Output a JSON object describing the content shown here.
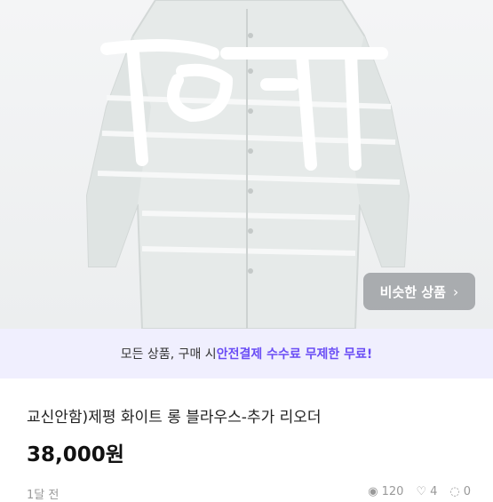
{
  "similar_button": {
    "label": "비슷한 상품"
  },
  "banner": {
    "prefix": "모든 상품, 구매 시 ",
    "highlight": "안전결제 수수료 무제한 무료!"
  },
  "product": {
    "title": "교신안함)제평 화이트 롱 블라우스-추가 리오더",
    "price": "38,000원"
  },
  "meta": {
    "time": "1달 전",
    "views": "120",
    "likes": "4",
    "chats": "0"
  }
}
